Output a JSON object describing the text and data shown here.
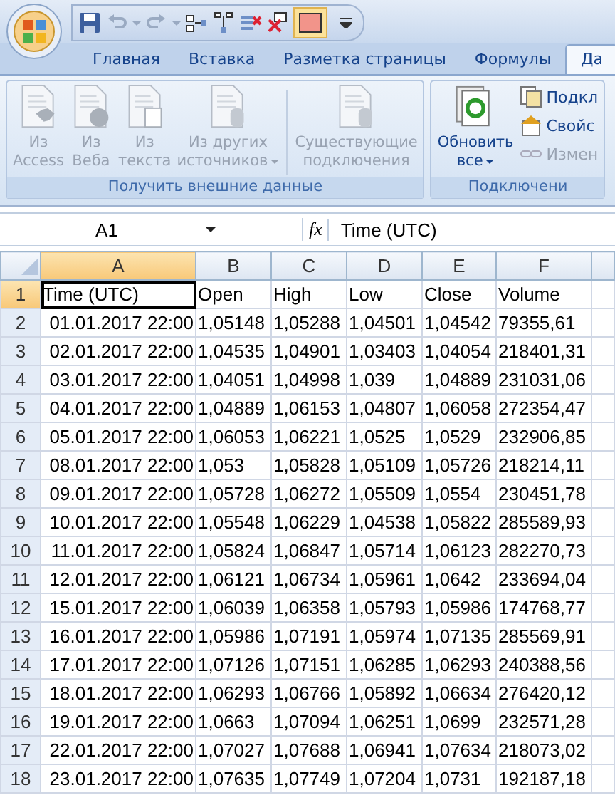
{
  "tabs": [
    {
      "label": "Главная",
      "selected": false
    },
    {
      "label": "Вставка",
      "selected": false
    },
    {
      "label": "Разметка страницы",
      "selected": false
    },
    {
      "label": "Формулы",
      "selected": false
    },
    {
      "label": "Да",
      "selected": true
    }
  ],
  "ribbon": {
    "groups": [
      {
        "title": "Получить внешние данные",
        "buttons": [
          {
            "kind": "large",
            "lines": [
              "Из",
              "Access"
            ],
            "disabled": true,
            "dropdown": false
          },
          {
            "kind": "large",
            "lines": [
              "Из",
              "Веба"
            ],
            "disabled": true,
            "dropdown": false
          },
          {
            "kind": "large",
            "lines": [
              "Из",
              "текста"
            ],
            "disabled": true,
            "dropdown": false
          },
          {
            "kind": "large",
            "lines": [
              "Из других",
              "источников"
            ],
            "disabled": true,
            "dropdown": true
          },
          {
            "kind": "separator"
          },
          {
            "kind": "large",
            "lines": [
              "Существующие",
              "подключения"
            ],
            "disabled": true,
            "dropdown": false
          }
        ]
      },
      {
        "title": "Подключени",
        "buttons": [
          {
            "kind": "large",
            "lines": [
              "Обновить",
              "все"
            ],
            "disabled": false,
            "dropdown": true
          },
          {
            "kind": "small",
            "lines": [
              "Подкл"
            ],
            "disabled": false
          },
          {
            "kind": "small",
            "lines": [
              "Свойс"
            ],
            "disabled": false
          },
          {
            "kind": "small",
            "lines": [
              "Измен"
            ],
            "disabled": true
          }
        ]
      }
    ]
  },
  "formula_bar": {
    "name_box": "A1",
    "function_label": "fx",
    "formula": "Time (UTC)"
  },
  "sheet": {
    "columns": [
      {
        "label": "A",
        "selected": true
      },
      {
        "label": "B",
        "selected": false
      },
      {
        "label": "C",
        "selected": false
      },
      {
        "label": "D",
        "selected": false
      },
      {
        "label": "E",
        "selected": false
      },
      {
        "label": "F",
        "selected": false
      }
    ],
    "rows": [
      {
        "number": "1",
        "selected": true,
        "cells": [
          "Time (UTC)",
          "Open",
          "High",
          "Low",
          "Close",
          "Volume"
        ]
      },
      {
        "number": "2",
        "selected": false,
        "cells": [
          "01.01.2017 22:00",
          "1,05148",
          "1,05288",
          "1,04501",
          "1,04542",
          "79355,61"
        ]
      },
      {
        "number": "3",
        "selected": false,
        "cells": [
          "02.01.2017 22:00",
          "1,04535",
          "1,04901",
          "1,03403",
          "1,04054",
          "218401,31"
        ]
      },
      {
        "number": "4",
        "selected": false,
        "cells": [
          "03.01.2017 22:00",
          "1,04051",
          "1,04998",
          "1,039",
          "1,04889",
          "231031,06"
        ]
      },
      {
        "number": "5",
        "selected": false,
        "cells": [
          "04.01.2017 22:00",
          "1,04889",
          "1,06153",
          "1,04807",
          "1,06058",
          "272354,47"
        ]
      },
      {
        "number": "6",
        "selected": false,
        "cells": [
          "05.01.2017 22:00",
          "1,06053",
          "1,06221",
          "1,0525",
          "1,0529",
          "232906,85"
        ]
      },
      {
        "number": "7",
        "selected": false,
        "cells": [
          "08.01.2017 22:00",
          "1,053",
          "1,05828",
          "1,05109",
          "1,05726",
          "218214,11"
        ]
      },
      {
        "number": "8",
        "selected": false,
        "cells": [
          "09.01.2017 22:00",
          "1,05728",
          "1,06272",
          "1,05509",
          "1,0554",
          "230451,78"
        ]
      },
      {
        "number": "9",
        "selected": false,
        "cells": [
          "10.01.2017 22:00",
          "1,05548",
          "1,06229",
          "1,04538",
          "1,05822",
          "285589,93"
        ]
      },
      {
        "number": "10",
        "selected": false,
        "cells": [
          "11.01.2017 22:00",
          "1,05824",
          "1,06847",
          "1,05714",
          "1,06123",
          "282270,73"
        ]
      },
      {
        "number": "11",
        "selected": false,
        "cells": [
          "12.01.2017 22:00",
          "1,06121",
          "1,06734",
          "1,05961",
          "1,0642",
          "233694,04"
        ]
      },
      {
        "number": "12",
        "selected": false,
        "cells": [
          "15.01.2017 22:00",
          "1,06039",
          "1,06358",
          "1,05793",
          "1,05986",
          "174768,77"
        ]
      },
      {
        "number": "13",
        "selected": false,
        "cells": [
          "16.01.2017 22:00",
          "1,05986",
          "1,07191",
          "1,05974",
          "1,07135",
          "285569,91"
        ]
      },
      {
        "number": "14",
        "selected": false,
        "cells": [
          "17.01.2017 22:00",
          "1,07126",
          "1,07151",
          "1,06285",
          "1,06293",
          "240388,56"
        ]
      },
      {
        "number": "15",
        "selected": false,
        "cells": [
          "18.01.2017 22:00",
          "1,06293",
          "1,06766",
          "1,05892",
          "1,06634",
          "276420,12"
        ]
      },
      {
        "number": "16",
        "selected": false,
        "cells": [
          "19.01.2017 22:00",
          "1,0663",
          "1,07094",
          "1,06251",
          "1,0699",
          "232571,28"
        ]
      },
      {
        "number": "17",
        "selected": false,
        "cells": [
          "22.01.2017 22:00",
          "1,07027",
          "1,07688",
          "1,06941",
          "1,07634",
          "218073,02"
        ]
      },
      {
        "number": "18",
        "selected": false,
        "cells": [
          "23.01.2017 22:00",
          "1,07635",
          "1,07749",
          "1,07204",
          "1,0731",
          "192187,18"
        ]
      }
    ]
  }
}
